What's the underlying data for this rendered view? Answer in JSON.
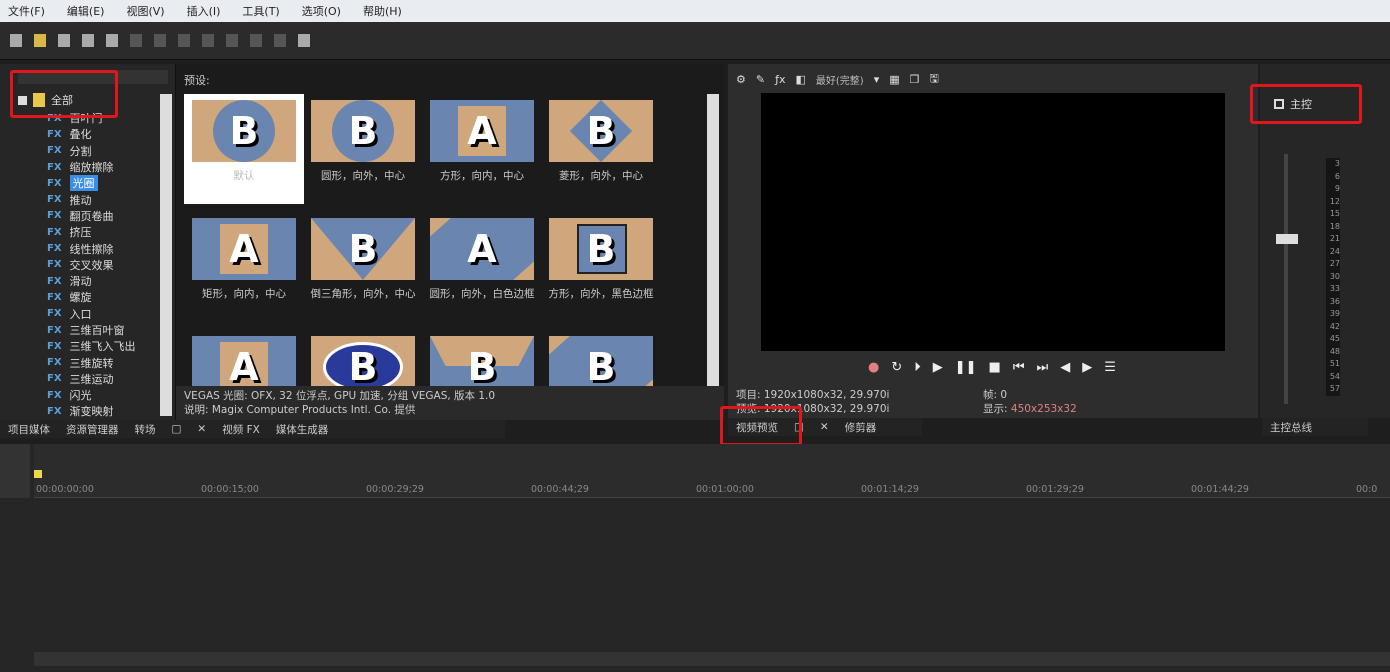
{
  "menu": [
    "文件(F)",
    "编辑(E)",
    "视图(V)",
    "插入(I)",
    "工具(T)",
    "选项(O)",
    "帮助(H)"
  ],
  "tree": {
    "root": "全部",
    "items": [
      "百叶门",
      "叠化",
      "分割",
      "缩放擦除",
      "光圈",
      "推动",
      "翻页卷曲",
      "挤压",
      "线性擦除",
      "交叉效果",
      "滑动",
      "螺旋",
      "入口",
      "三维百叶窗",
      "三维飞入飞出",
      "三维旋转",
      "三维运动",
      "闪光",
      "渐变映射"
    ],
    "selected_index": 4
  },
  "presets_label": "预设:",
  "thumbnails": [
    {
      "letter": "B",
      "caption": "默认"
    },
    {
      "letter": "B",
      "caption": "圆形，向外，中心"
    },
    {
      "letter": "A",
      "caption": "方形，向内，中心"
    },
    {
      "letter": "B",
      "caption": "菱形，向外，中心"
    },
    {
      "letter": "A",
      "caption": "矩形，向内，中心"
    },
    {
      "letter": "B",
      "caption": "倒三角形，向外，中心"
    },
    {
      "letter": "A",
      "caption": "圆形，向外，白色边框"
    },
    {
      "letter": "B",
      "caption": "方形，向外，黑色边框"
    },
    {
      "letter": "A",
      "caption": ""
    },
    {
      "letter": "B",
      "caption": ""
    },
    {
      "letter": "B",
      "caption": ""
    },
    {
      "letter": "B",
      "caption": ""
    }
  ],
  "info": {
    "line1": "VEGAS 光圈: OFX, 32 位浮点, GPU 加速, 分组 VEGAS, 版本 1.0",
    "line2": "说明: Magix Computer Products Intl. Co. 提供"
  },
  "tabs_left": [
    "项目媒体",
    "资源管理器",
    "转场",
    "视频 FX",
    "媒体生成器"
  ],
  "preview": {
    "quality": "最好(完整)",
    "project": "项目: 1920x1080x32, 29.970i",
    "preview": "预览: 1920x1080x32, 29.970i",
    "frame_label": "帧:",
    "frame": "0",
    "display_label": "显示:",
    "display": "450x253x32"
  },
  "tabs_mid": [
    "视频预览",
    "修剪器"
  ],
  "master": {
    "label": "主控",
    "tab": "主控总线",
    "scale": [
      "3",
      "6",
      "9",
      "12",
      "15",
      "18",
      "21",
      "24",
      "27",
      "30",
      "33",
      "36",
      "39",
      "42",
      "45",
      "48",
      "51",
      "54",
      "57"
    ]
  },
  "timeline": {
    "timecodes": [
      "00:00:00;00",
      "00:00:15;00",
      "00:00:29;29",
      "00:00:44;29",
      "00:01:00;00",
      "00:01:14;29",
      "00:01:29;29",
      "00:01:44;29",
      "00:0"
    ]
  },
  "colors": {
    "highlight": "#e2161b",
    "accent": "#3a8ee6"
  }
}
